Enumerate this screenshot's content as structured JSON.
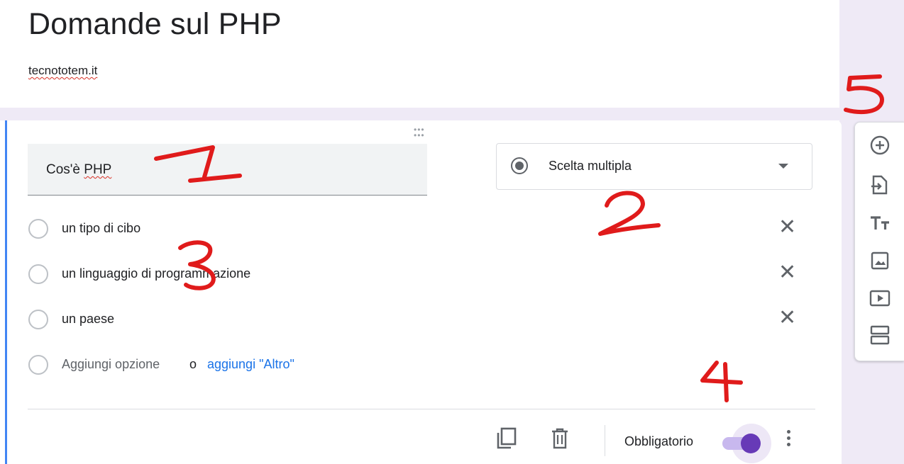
{
  "form": {
    "title": "Domande sul PHP",
    "description": "tecnototem.it"
  },
  "question": {
    "title_prefix": "Cos'è ",
    "title_underlined": "PHP",
    "type": "Scelta multipla",
    "options": [
      {
        "label": "un tipo di cibo"
      },
      {
        "label": "un linguaggio di programmazione"
      },
      {
        "label": "un paese"
      }
    ],
    "add_option_label": "Aggiungi opzione",
    "or_label": "o",
    "add_other_label": "aggiungi \"Altro\"",
    "required_label": "Obbligatorio",
    "required_on": true
  },
  "toolbar": {
    "items": [
      {
        "icon": "add-question-icon"
      },
      {
        "icon": "import-questions-icon"
      },
      {
        "icon": "add-title-description-icon"
      },
      {
        "icon": "add-image-icon"
      },
      {
        "icon": "add-video-icon"
      },
      {
        "icon": "add-section-icon"
      }
    ]
  },
  "annotations": {
    "n1": "1",
    "n2": "2",
    "n3": "3",
    "n4": "4",
    "n5": "5"
  },
  "colors": {
    "accent": "#673ab7",
    "link": "#1a73e8",
    "annotation_red": "#e01b1b",
    "background": "#efeaf6"
  }
}
